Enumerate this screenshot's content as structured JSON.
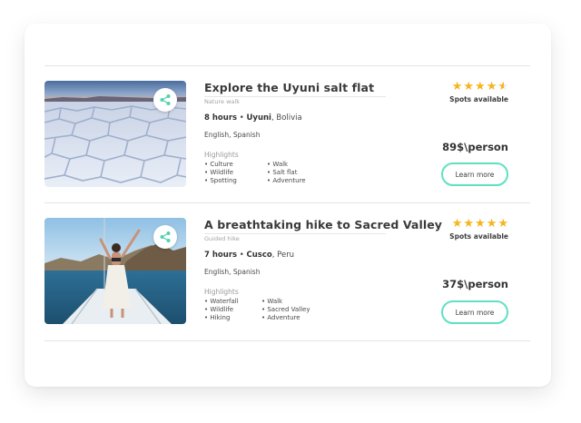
{
  "tours": [
    {
      "title": "Explore the Uyuni salt flat",
      "subtitle": "Nature walk",
      "duration": "8 hours",
      "sep": " • ",
      "city": "Uyuni",
      "country": ", Bolivia",
      "languages": "English, Spanish",
      "highlights_label": "Highlights",
      "highlights_col1": [
        "• Culture",
        "• Wildlife",
        "• Spotting"
      ],
      "highlights_col2": [
        "• Walk",
        "• Salt flat",
        "• Adventure"
      ],
      "rating": 4.5,
      "spots": "Spots available",
      "price": "89$\\person",
      "cta": "Learn more",
      "image": "salt-flat-photo",
      "share_icon": "share-icon"
    },
    {
      "title": "A breathtaking hike to Sacred Valley",
      "subtitle": "Guided hike",
      "duration": "7 hours",
      "sep": " • ",
      "city": "Cusco",
      "country": ", Peru",
      "languages": "English, Spanish",
      "highlights_label": "Highlights",
      "highlights_col1": [
        "• Waterfall",
        "• Wildlife",
        "• Hiking"
      ],
      "highlights_col2": [
        "• Walk",
        "• Sacred Valley",
        "• Adventure"
      ],
      "rating": 5,
      "spots": "Spots available",
      "price": "37$\\person",
      "cta": "Learn more",
      "image": "boat-woman-photo",
      "share_icon": "share-icon"
    }
  ],
  "colors": {
    "accent": "#5fe0c3",
    "star": "#f6b51e",
    "share": "#4fd3ad"
  }
}
